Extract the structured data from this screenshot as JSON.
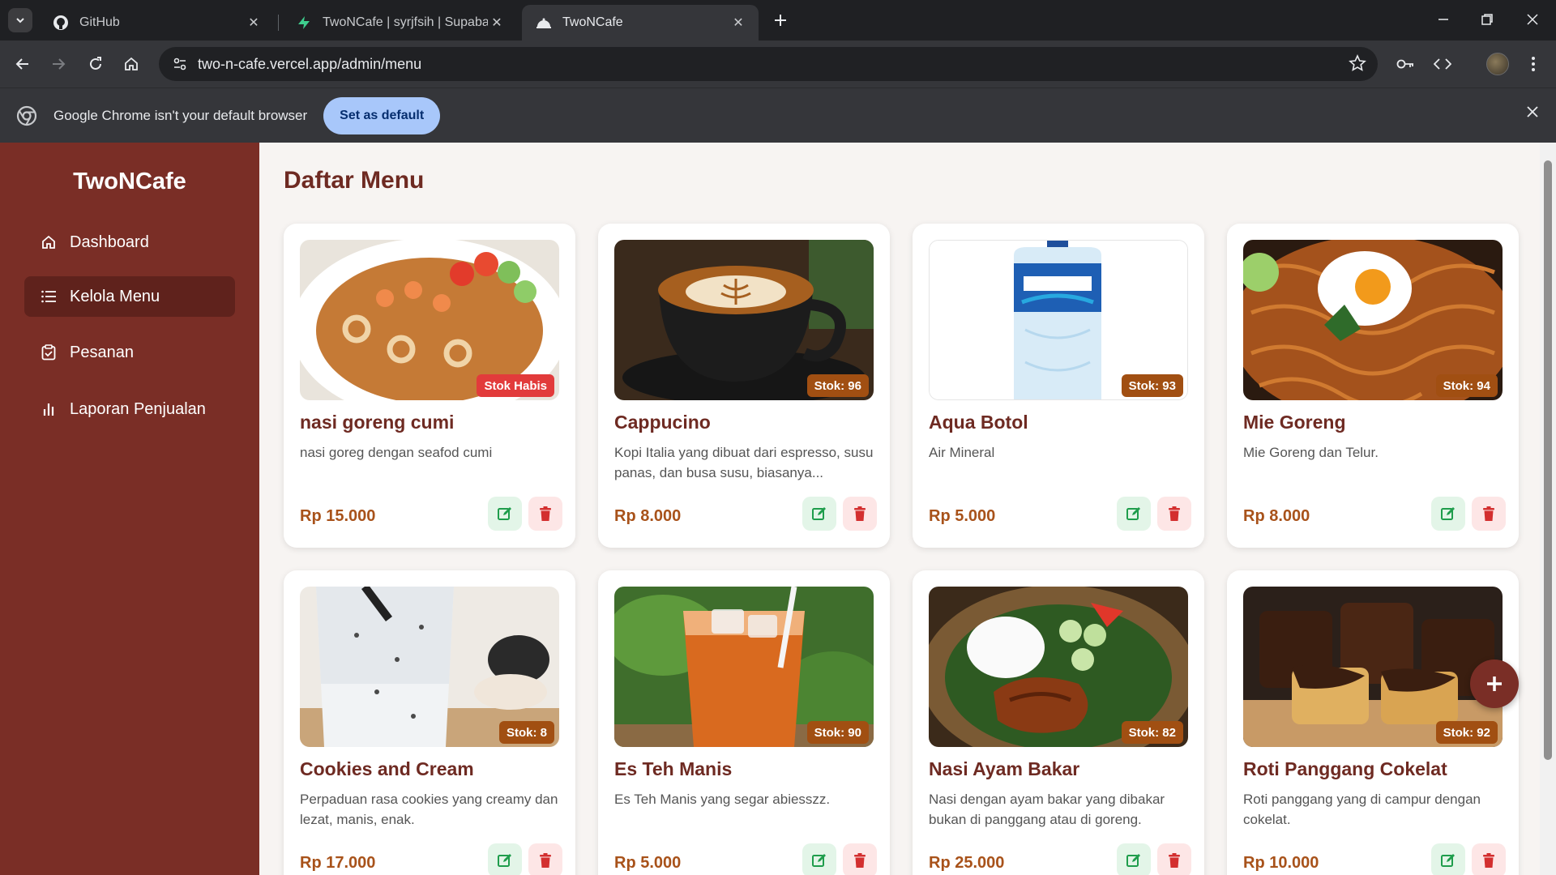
{
  "browser": {
    "tabs": [
      {
        "title": "GitHub",
        "icon": "github-icon",
        "active": false
      },
      {
        "title": "TwoNCafe | syrjfsih | Supabase",
        "icon": "supabase-icon",
        "active": false
      },
      {
        "title": "TwoNCafe",
        "icon": "cafe-icon",
        "active": true
      }
    ],
    "url": "two-n-cafe.vercel.app/admin/menu",
    "infobar": {
      "message": "Google Chrome isn't your default browser",
      "button": "Set as default"
    }
  },
  "sidebar": {
    "brand": "TwoNCafe",
    "items": [
      {
        "label": "Dashboard",
        "icon": "home-icon",
        "active": false
      },
      {
        "label": "Kelola Menu",
        "icon": "list-icon",
        "active": true
      },
      {
        "label": "Pesanan",
        "icon": "clipboard-icon",
        "active": false
      },
      {
        "label": "Laporan Penjualan",
        "icon": "bar-chart-icon",
        "active": false
      }
    ]
  },
  "main": {
    "title": "Daftar Menu",
    "menu": [
      {
        "name": "nasi goreng cumi",
        "desc": "nasi goreg dengan seafod cumi",
        "price": "Rp 15.000",
        "badge": "Stok Habis",
        "image": "fried-rice"
      },
      {
        "name": "Cappucino",
        "desc": "Kopi Italia yang dibuat dari espresso, susu panas, dan busa susu, biasanya...",
        "price": "Rp 8.000",
        "badge": "Stok: 96",
        "image": "coffee"
      },
      {
        "name": "Aqua Botol",
        "desc": "Air Mineral",
        "price": "Rp 5.000",
        "badge": "Stok: 93",
        "image": "water-bottle"
      },
      {
        "name": "Mie Goreng",
        "desc": "Mie Goreng dan Telur.",
        "price": "Rp 8.000",
        "badge": "Stok: 94",
        "image": "fried-noodles"
      },
      {
        "name": "Cookies and Cream",
        "desc": "Perpaduan rasa cookies yang creamy dan lezat, manis, enak.",
        "price": "Rp 17.000",
        "badge": "Stok: 8",
        "image": "milkshake"
      },
      {
        "name": "Es Teh Manis",
        "desc": "Es Teh Manis yang segar abiesszz.",
        "price": "Rp 5.000",
        "badge": "Stok: 90",
        "image": "iced-tea"
      },
      {
        "name": "Nasi Ayam Bakar",
        "desc": "Nasi dengan ayam bakar yang dibakar bukan di panggang atau di goreng.",
        "price": "Rp 25.000",
        "badge": "Stok: 82",
        "image": "grilled-chicken"
      },
      {
        "name": "Roti Panggang Cokelat",
        "desc": "Roti panggang yang di campur dengan cokelat.",
        "price": "Rp 10.000",
        "badge": "Stok: 92",
        "image": "chocolate-toast"
      }
    ]
  },
  "colors": {
    "sidebar": "#7a2e26",
    "accent": "#6e2a22",
    "price": "#a8521a",
    "badge": "#a14f12",
    "badge_out": "#e23b3b"
  }
}
